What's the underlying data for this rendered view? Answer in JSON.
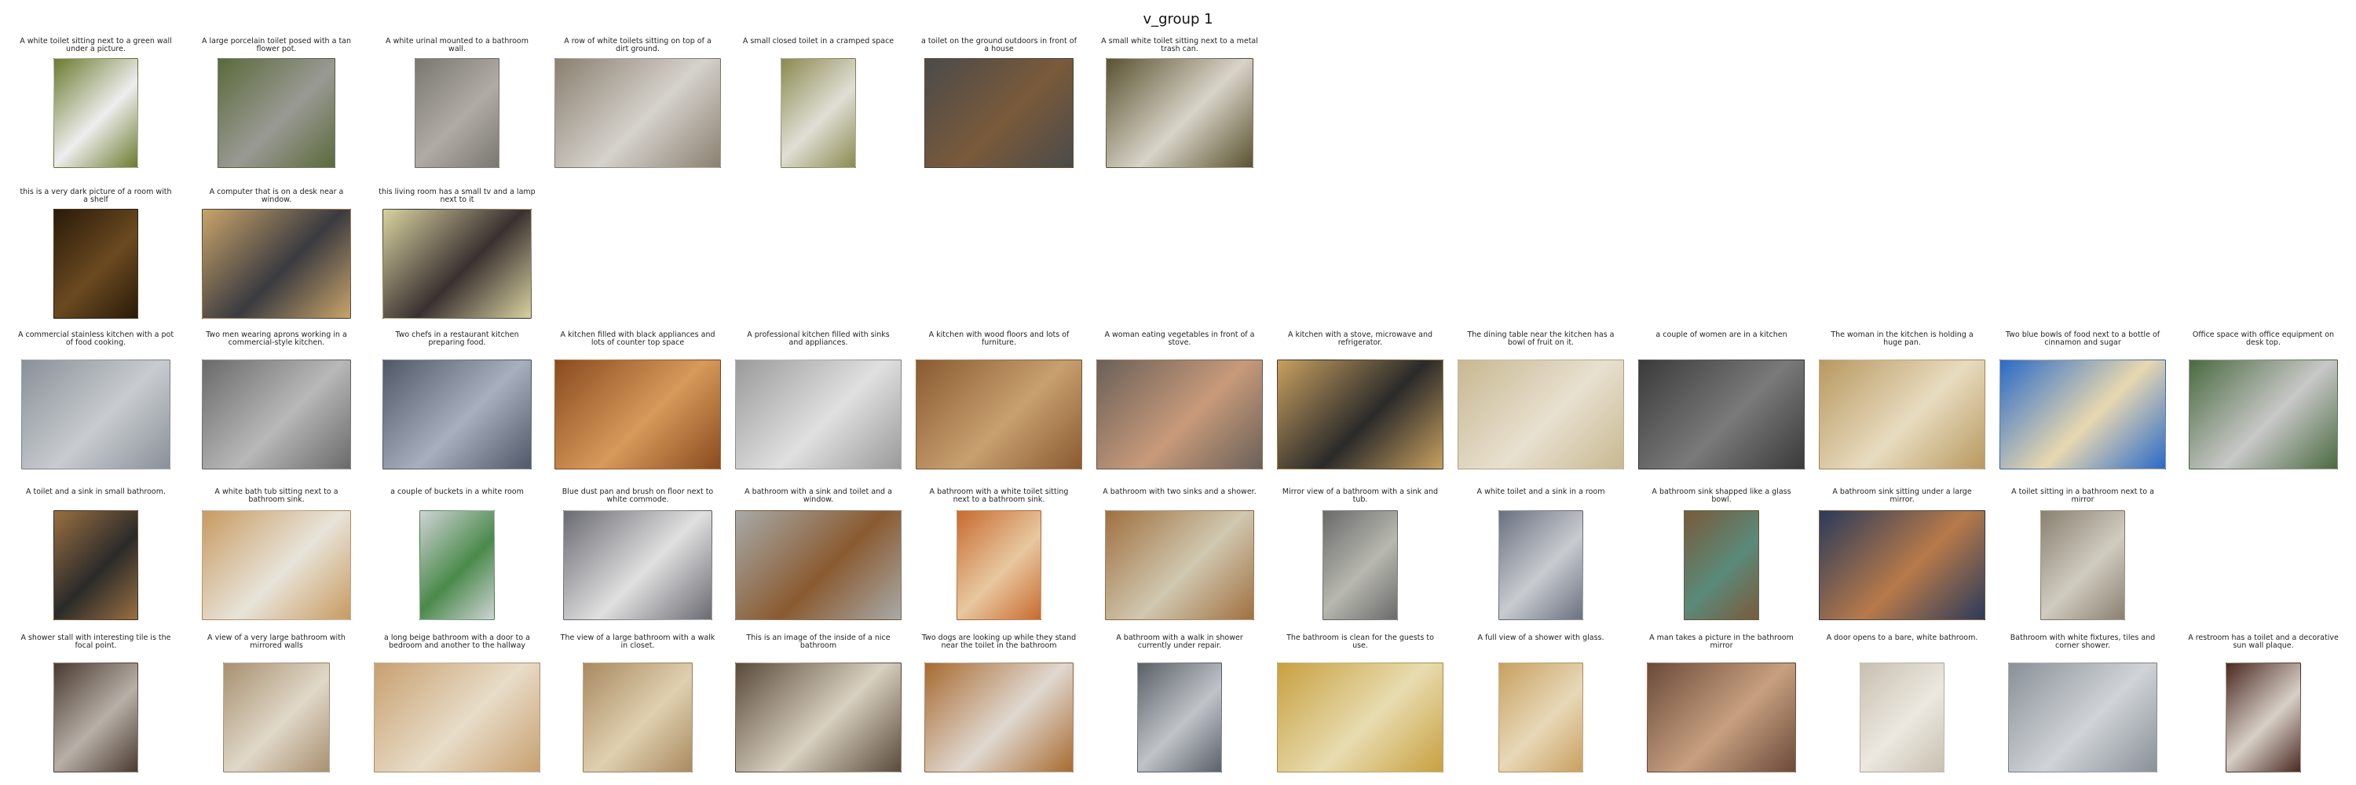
{
  "title": "v_group 1",
  "rows": [
    {
      "items": [
        {
          "caption": "A white toilet sitting next to a green wall under a picture.",
          "colors": [
            "#6b7a2f",
            "#eeeeee"
          ]
        },
        {
          "caption": "A large porcelain toilet posed with a tan flower pot.",
          "colors": [
            "#5a6a3a",
            "#9a9a95"
          ]
        },
        {
          "caption": "A white urinal mounted to a bathroom wall.",
          "colors": [
            "#7a7670",
            "#b0aca5"
          ]
        },
        {
          "caption": "A row of white toilets sitting on top of a dirt ground.",
          "colors": [
            "#8a8070",
            "#d6d2cc"
          ]
        },
        {
          "caption": "A small closed toilet in a cramped space",
          "colors": [
            "#8a8a50",
            "#e0dfd6"
          ]
        },
        {
          "caption": "a toilet on the ground outdoors in front of a house",
          "colors": [
            "#4b4b4b",
            "#7a5a3a"
          ]
        },
        {
          "caption": "A small white toilet sitting next to a metal trash can.",
          "colors": [
            "#5a5230",
            "#d8d4c8"
          ]
        }
      ]
    },
    {
      "items": [
        {
          "caption": "this is a very dark picture of a room with a shelf",
          "colors": [
            "#2a1a0a",
            "#6a4a20"
          ]
        },
        {
          "caption": "A computer that is on a desk near a window.",
          "colors": [
            "#c9a46a",
            "#3a3a40"
          ]
        },
        {
          "caption": "this living room has a small tv and a lamp next to it",
          "colors": [
            "#d8d2a0",
            "#3a3030"
          ]
        }
      ]
    },
    {
      "items": [
        {
          "caption": "A commercial stainless kitchen with a pot of food cooking.",
          "colors": [
            "#8a9098",
            "#c8ccd0"
          ]
        },
        {
          "caption": "Two men wearing aprons working in a commercial-style kitchen.",
          "colors": [
            "#6a6a6a",
            "#b8b8b8"
          ]
        },
        {
          "caption": "Two chefs in a restaurant kitchen preparing food.",
          "colors": [
            "#505868",
            "#a8b0c0"
          ]
        },
        {
          "caption": "A kitchen filled with black appliances and lots of counter top space",
          "colors": [
            "#8a4a20",
            "#d89a5a"
          ]
        },
        {
          "caption": "A professional kitchen filled with sinks and appliances.",
          "colors": [
            "#9a9a9a",
            "#e0e0e0"
          ]
        },
        {
          "caption": "A kitchen with wood floors and lots of furniture.",
          "colors": [
            "#8a5a30",
            "#c8a070"
          ]
        },
        {
          "caption": "A woman eating vegetables in front of a stove.",
          "colors": [
            "#6a6058",
            "#c89a7a"
          ]
        },
        {
          "caption": "A kitchen with a stove, microwave and refrigerator.",
          "colors": [
            "#c8a060",
            "#2a2a2a"
          ]
        },
        {
          "caption": "The dining table near the kitchen has a bowl of fruit on it.",
          "colors": [
            "#c8b890",
            "#e8e0d0"
          ]
        },
        {
          "caption": "a couple of women  are in a kitchen",
          "colors": [
            "#3a3a3a",
            "#7a7a7a"
          ]
        },
        {
          "caption": "The woman in the kitchen is holding a huge pan.",
          "colors": [
            "#b89860",
            "#e8dcc0"
          ]
        },
        {
          "caption": "Two blue bowls of food next to a bottle of cinnamon and sugar",
          "colors": [
            "#2a6ac8",
            "#e8d8b0"
          ]
        },
        {
          "caption": "Office space with office equipment on desk top.",
          "colors": [
            "#4a6a40",
            "#c8c8c8"
          ]
        }
      ]
    },
    {
      "items": [
        {
          "caption": "A toilet and a sink in small bathroom.",
          "colors": [
            "#9a7040",
            "#2a2a2a"
          ]
        },
        {
          "caption": "A white bath tub sitting next to a bathroom sink.",
          "colors": [
            "#c89a60",
            "#e8e4da"
          ]
        },
        {
          "caption": "a couple of buckets in a white room",
          "colors": [
            "#cfd3d6",
            "#4a8a4a"
          ]
        },
        {
          "caption": "Blue dust pan and brush on floor next to white commode.",
          "colors": [
            "#6a6a72",
            "#e0e0e0"
          ]
        },
        {
          "caption": "A bathroom with a sink and toilet and a window.",
          "colors": [
            "#a8aaa8",
            "#8a5a30"
          ]
        },
        {
          "caption": "A bathroom with a white toilet sitting next to a bathroom sink.",
          "colors": [
            "#c86a30",
            "#e8c8a0"
          ]
        },
        {
          "caption": "A bathroom with two sinks and a shower.",
          "colors": [
            "#a07040",
            "#d0c8b0"
          ]
        },
        {
          "caption": "Mirror view of a bathroom with a sink and tub.",
          "colors": [
            "#6a6a6a",
            "#b8b8b0"
          ]
        },
        {
          "caption": "A white toilet and a sink in a room",
          "colors": [
            "#6a7080",
            "#c8ccd0"
          ]
        },
        {
          "caption": "A bathroom sink shapped like a glass bowl.",
          "colors": [
            "#7a5a3a",
            "#5a8a7a"
          ]
        },
        {
          "caption": "A bathroom sink sitting under a large mirror.",
          "colors": [
            "#2a3a5a",
            "#b87a4a"
          ]
        },
        {
          "caption": "A toilet sitting in a bathroom next to a mirror",
          "colors": [
            "#8a8070",
            "#d0ccc0"
          ]
        }
      ]
    },
    {
      "items": [
        {
          "caption": "A shower stall with interesting tile is the focal point.",
          "colors": [
            "#4a3a30",
            "#b8b0a8"
          ]
        },
        {
          "caption": "A view of a very large bathroom with mirrored walls",
          "colors": [
            "#a89070",
            "#e0d8c8"
          ]
        },
        {
          "caption": "a long beige bathroom with a door to a bedroom and another to the hallway",
          "colors": [
            "#c8a070",
            "#e8dcc8"
          ]
        },
        {
          "caption": "The view of a large bathroom with a walk in closet.",
          "colors": [
            "#a88a60",
            "#e0d0b0"
          ]
        },
        {
          "caption": "This is an image of the inside of a nice bathroom",
          "colors": [
            "#5a4a3a",
            "#d8d0c0"
          ]
        },
        {
          "caption": "Two dogs are looking up while they stand near the toilet in the bathroom",
          "colors": [
            "#a86a30",
            "#e0d8d0"
          ]
        },
        {
          "caption": "A bathroom with a walk in shower currently under repair.",
          "colors": [
            "#5a6068",
            "#c0c4c8"
          ]
        },
        {
          "caption": "The bathroom is clean for the guests to use.",
          "colors": [
            "#c8a040",
            "#e8dcb0"
          ]
        },
        {
          "caption": "A full view of a shower with glass.",
          "colors": [
            "#c8a060",
            "#e8d8b8"
          ]
        },
        {
          "caption": "A man takes a picture in the bathroom mirror",
          "colors": [
            "#6a4a3a",
            "#c8a080"
          ]
        },
        {
          "caption": "A door opens to a bare, white bathroom.",
          "colors": [
            "#c8c0b0",
            "#ece8e0"
          ]
        },
        {
          "caption": "Bathroom with white fixtures, tiles and corner shower.",
          "colors": [
            "#8a9098",
            "#d0d4d8"
          ]
        },
        {
          "caption": "A restroom has a toilet and a decorative sun wall plaque.",
          "colors": [
            "#4a2a20",
            "#d8d0c8"
          ]
        }
      ]
    }
  ]
}
